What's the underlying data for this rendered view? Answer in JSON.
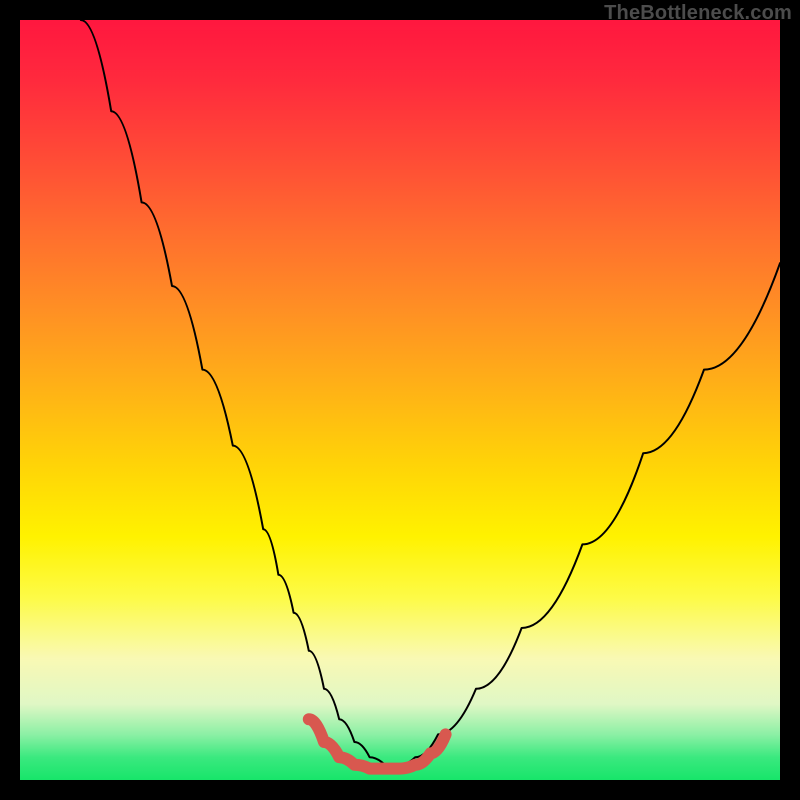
{
  "watermark": "TheBottleneck.com",
  "chart_data": {
    "type": "line",
    "title": "",
    "xlabel": "",
    "ylabel": "",
    "xlim": [
      0,
      100
    ],
    "ylim": [
      0,
      100
    ],
    "series": [
      {
        "name": "black-curve",
        "color": "#000000",
        "x": [
          8,
          12,
          16,
          20,
          24,
          28,
          32,
          34,
          36,
          38,
          40,
          42,
          44,
          46,
          48,
          50,
          52,
          55,
          60,
          66,
          74,
          82,
          90,
          100
        ],
        "values": [
          100,
          88,
          76,
          65,
          54,
          44,
          33,
          27,
          22,
          17,
          12,
          8,
          5,
          3,
          2,
          2,
          3,
          6,
          12,
          20,
          31,
          43,
          54,
          68
        ]
      },
      {
        "name": "red-highlight",
        "color": "#d8584f",
        "x": [
          38,
          40,
          42,
          44,
          46,
          48,
          50,
          52,
          54,
          56
        ],
        "values": [
          8,
          5,
          3,
          2,
          1.5,
          1.5,
          1.5,
          2,
          3.5,
          6
        ]
      }
    ]
  }
}
